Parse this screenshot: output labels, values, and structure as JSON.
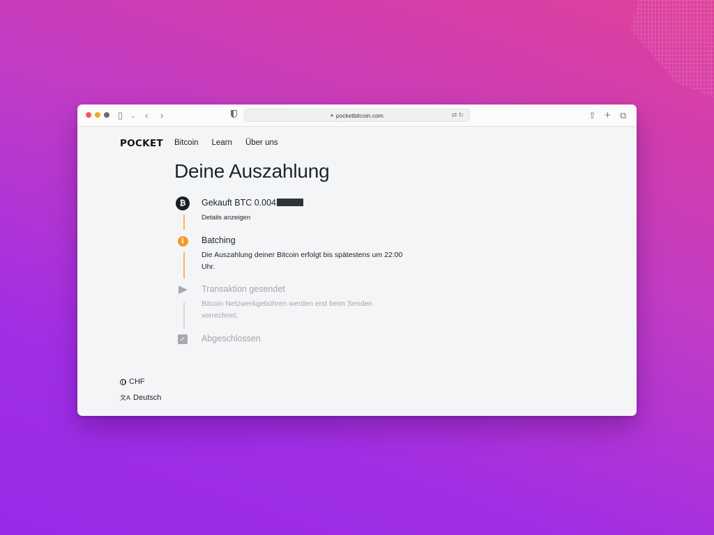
{
  "browser": {
    "url": "pocketbitcoin.com",
    "traffic_lights": [
      "#f5585a",
      "#f5a623",
      "#c7c7c7"
    ]
  },
  "site": {
    "logo": "POCKET",
    "nav": [
      "Bitcoin",
      "Learn",
      "Über uns"
    ]
  },
  "page": {
    "title": "Deine Auszahlung"
  },
  "steps": [
    {
      "icon": "bitcoin-icon",
      "status": "done",
      "title": "Gekauft BTC 0.004",
      "title_redacted": true,
      "subtitle": "Details anzeigen"
    },
    {
      "icon": "info-icon",
      "status": "active",
      "title": "Batching",
      "subtitle": "Die Auszahlung deiner Bitcoin erfolgt bis spätestens um 22:00 Uhr."
    },
    {
      "icon": "send-icon",
      "status": "pending",
      "title": "Transaktion gesendet",
      "subtitle": "Bitcoin Netzwerkgebühren werden erst beim Senden verrechnet."
    },
    {
      "icon": "checkbox-icon",
      "status": "pending",
      "title": "Abgeschlossen",
      "subtitle": ""
    }
  ],
  "footer": {
    "currency": "CHF",
    "language": "Deutsch"
  },
  "colors": {
    "accent": "#f39a2b",
    "dark": "#1b1f24",
    "muted": "#a4a7ab",
    "line_active": "#f5b56a",
    "line_pending": "#d6d7d9"
  }
}
